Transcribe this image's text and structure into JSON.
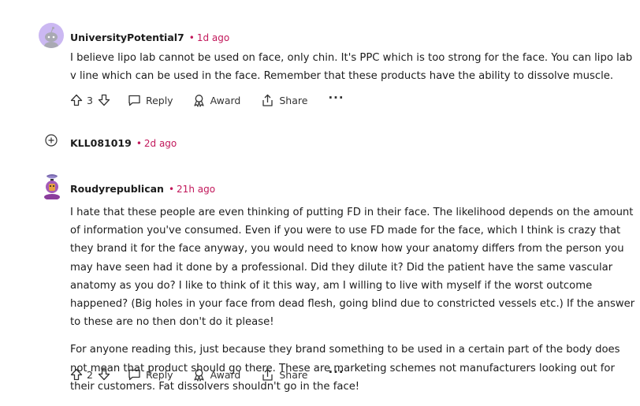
{
  "comments": [
    {
      "username": "UniversityPotential7",
      "separator": "•",
      "time": "1d ago",
      "paragraphs": [
        "I believe lipo lab cannot be used on face, only chin. It's PPC which is too strong for the face. You can lipo lab v line which can be used in the face. Remember that these products have the ability to dissolve muscle."
      ],
      "votes": "3",
      "reply_label": "Reply",
      "award_label": "Award",
      "share_label": "Share",
      "more_label": "···",
      "avatar_color": "#c9b7f0"
    },
    {
      "username": "KLL081019",
      "separator": "•",
      "time": "2d ago",
      "collapsed": true
    },
    {
      "username": "Roudyrepublican",
      "separator": "•",
      "time": "21h ago",
      "paragraphs": [
        "I hate that these people are even thinking of putting FD in their face. The likelihood depends on the amount of information you've consumed. Even if you were to use FD made for the face, which I think is crazy that they brand it for the face anyway, you would need to know how your anatomy differs from the person you may have seen had it done by a professional. Did they dilute it? Did the patient have the same vascular anatomy as you do? I like to think of it this way, am I willing to live with myself if the worst outcome happened? (Big holes in your face from dead flesh, going blind due to constricted vessels etc.) If the answer to these are no then don't do it please!",
        "For anyone reading this, just because they brand something to be used in a certain part of the body does not mean that product should go there. These are marketing schemes not manufacturers looking out for their customers. Fat dissolvers shouldn't go in the face!"
      ],
      "votes": "2",
      "reply_label": "Reply",
      "award_label": "Award",
      "share_label": "Share",
      "more_label": "···"
    }
  ],
  "colors": {
    "timestamp": "#c2185b",
    "text": "#1c1c1c"
  },
  "icons": [
    "upvote-icon",
    "downvote-icon",
    "comment-icon",
    "award-icon",
    "share-icon",
    "expand-icon",
    "avatar-icon"
  ]
}
